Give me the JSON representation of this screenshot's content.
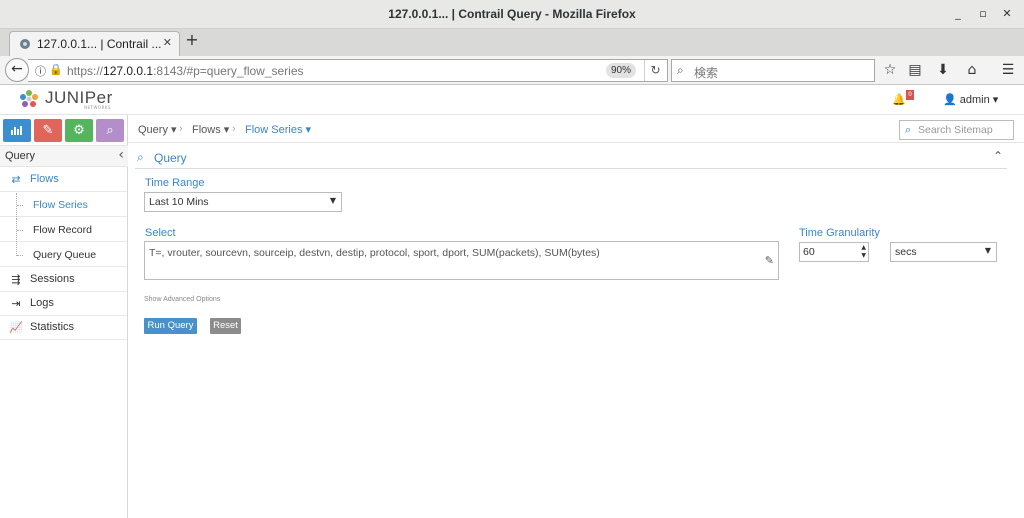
{
  "window": {
    "title": "127.0.0.1... | Contrail Query - Mozilla Firefox",
    "minimize": "_",
    "maximize": "▫",
    "close": "✕"
  },
  "tab": {
    "title": "127.0.0.1... | Contrail ...",
    "close": "✕"
  },
  "new_tab": "+",
  "urlbar": {
    "scheme": "https://",
    "host": "127.0.0.1",
    "rest": ":8143/#p=query_flow_series",
    "zoom": "90%"
  },
  "searchbar": {
    "placeholder": "検索"
  },
  "app": {
    "logo": "JUNIPer",
    "logo_sub": "NETWORKS",
    "notification_count": "0",
    "user": "admin"
  },
  "sidebar": {
    "mode_colors": [
      "#3b8fd0",
      "#e0655b",
      "#55b55f",
      "#b48ec9"
    ],
    "header": "Query",
    "items": [
      {
        "label": "Flows",
        "icon": "flows-icon"
      },
      {
        "label": "Sessions",
        "icon": "sessions-icon"
      },
      {
        "label": "Logs",
        "icon": "logs-icon"
      },
      {
        "label": "Statistics",
        "icon": "statistics-icon"
      }
    ],
    "subitems": [
      "Flow Series",
      "Flow Record",
      "Query Queue"
    ]
  },
  "breadcrumb": {
    "items": [
      "Query",
      "Flows",
      "Flow Series"
    ]
  },
  "sitemap": {
    "placeholder": "Search Sitemap"
  },
  "query": {
    "title": "Query",
    "time_range_label": "Time Range",
    "time_range_value": "Last 10 Mins",
    "select_label": "Select",
    "select_value": "T=, vrouter, sourcevn, sourceip, destvn, destip, protocol, sport, dport, SUM(packets), SUM(bytes)",
    "granularity_label": "Time Granularity",
    "granularity_value": "60",
    "granularity_unit": "secs",
    "advanced_link": "Show Advanced Options",
    "run_label": "Run Query",
    "reset_label": "Reset",
    "colors": {
      "accent": "#3a86c6",
      "run": "#4a90c9",
      "reset": "#8c8c8c"
    }
  }
}
